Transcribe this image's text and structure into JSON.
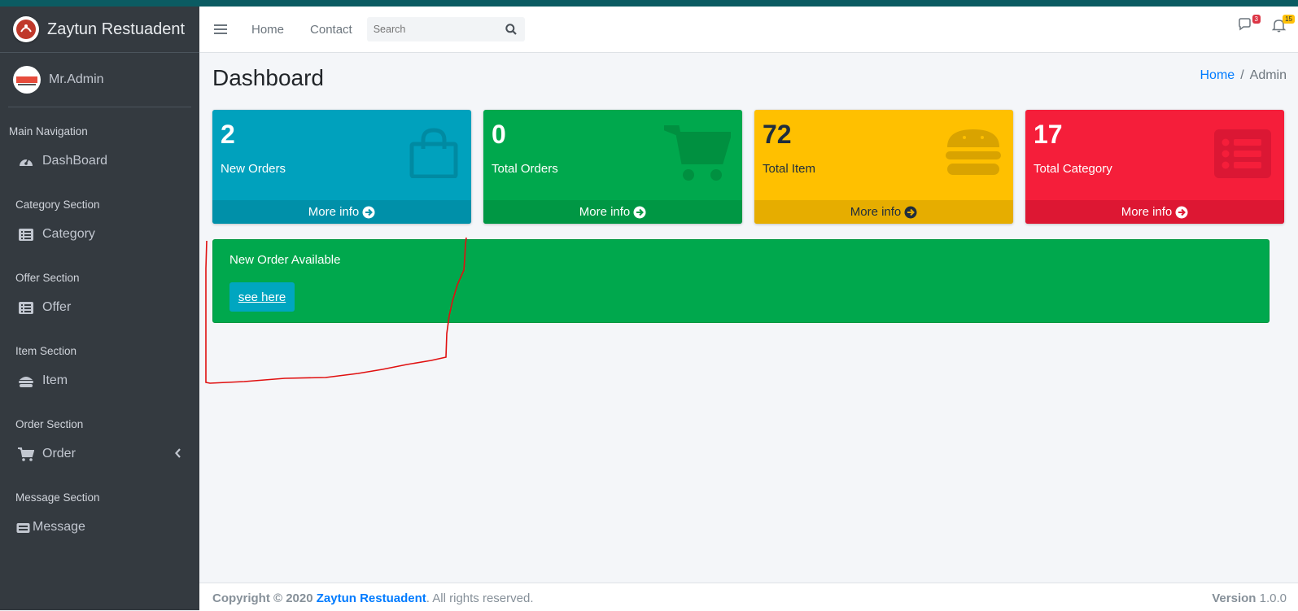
{
  "sidebar": {
    "brand": "Zaytun Restuadent",
    "user": "Mr.Admin",
    "main_nav_header": "Main Navigation",
    "items": [
      {
        "header": "",
        "label": "DashBoard"
      },
      {
        "header": "Category Section",
        "label": "Category"
      },
      {
        "header": "Offer Section",
        "label": "Offer"
      },
      {
        "header": "Item Section",
        "label": "Item"
      },
      {
        "header": "Order Section",
        "label": "Order"
      },
      {
        "header": "Message Section",
        "label": "Message"
      }
    ]
  },
  "navbar": {
    "links": [
      "Home",
      "Contact"
    ],
    "search_placeholder": "Search",
    "messages_badge": "3",
    "notifications_badge": "15"
  },
  "page": {
    "title": "Dashboard",
    "breadcrumb": [
      "Home",
      "Admin"
    ]
  },
  "boxes": [
    {
      "value": "2",
      "label": "New Orders",
      "more": "More info",
      "color": "#00a1bd",
      "icon": "shopping-bag-icon"
    },
    {
      "value": "0",
      "label": "Total Orders",
      "more": "More info",
      "color": "#00a84d",
      "icon": "cart-icon"
    },
    {
      "value": "72",
      "label": "Total Item",
      "more": "More info",
      "color": "#ffc000",
      "icon": "burger-icon"
    },
    {
      "value": "17",
      "label": "Total Category",
      "more": "More info",
      "color": "#f51e3a",
      "icon": "list-icon"
    }
  ],
  "alert": {
    "title": "New Order Available",
    "button": "see here"
  },
  "footer": {
    "copyright": "Copyright © 2020",
    "brand": "Zaytun Restuadent",
    "rights": ". All rights reserved.",
    "version_label": "Version",
    "version": "1.0.0"
  }
}
